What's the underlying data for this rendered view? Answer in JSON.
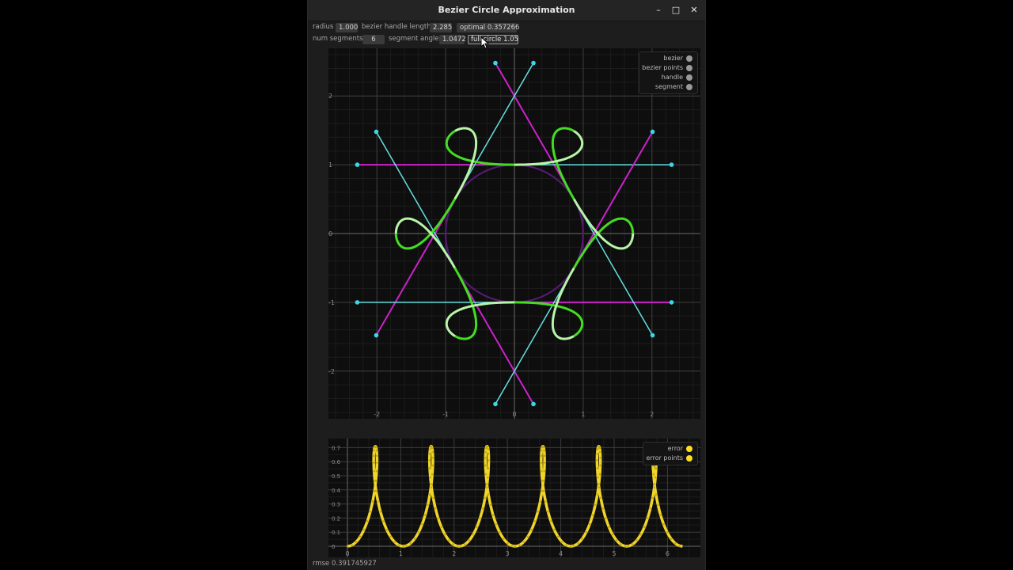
{
  "window": {
    "title": "Bezier Circle Approximation"
  },
  "controls": {
    "radius_label": "radius",
    "radius_value": "1.000",
    "handle_label": "bezier handle length",
    "handle_value": "2.285",
    "optimal_button": "optimal 0.357266",
    "segments_label": "num segments",
    "segments_value": "6",
    "angle_label": "segment angle",
    "angle_value": "1.0472",
    "fullcircle_button": "full circle 1.05"
  },
  "main_plot": {
    "x_ticks": [
      "-2",
      "-1",
      "0",
      "1",
      "2"
    ],
    "y_ticks": [
      "2",
      "1",
      "0",
      "-1",
      "-2"
    ],
    "legend": [
      {
        "label": "bezier",
        "color": "#9a9a9a"
      },
      {
        "label": "bezier points",
        "color": "#9a9a9a"
      },
      {
        "label": "handle",
        "color": "#9a9a9a"
      },
      {
        "label": "segment",
        "color": "#9a9a9a"
      }
    ],
    "colors": {
      "circle": "#1a1acc",
      "arc": "#5a1a6a",
      "bezier_a": "#44dd22",
      "bezier_b": "#b8f5a8",
      "handle_a": "#cc22cc",
      "handle_b": "#66e0e0",
      "point": "#3ad7e6"
    }
  },
  "error_plot": {
    "x_ticks": [
      "0",
      "1",
      "2",
      "3",
      "4",
      "5",
      "6"
    ],
    "y_ticks": [
      "0.7",
      "0.6",
      "0.5",
      "0.4",
      "0.3",
      "0.2",
      "0.1",
      "0"
    ],
    "legend": [
      {
        "label": "error",
        "color": "#ffe020"
      },
      {
        "label": "error points",
        "color": "#ffe020"
      }
    ],
    "color": "#f0d52a"
  },
  "status": {
    "rmse": "rmse 0.391745927"
  }
}
